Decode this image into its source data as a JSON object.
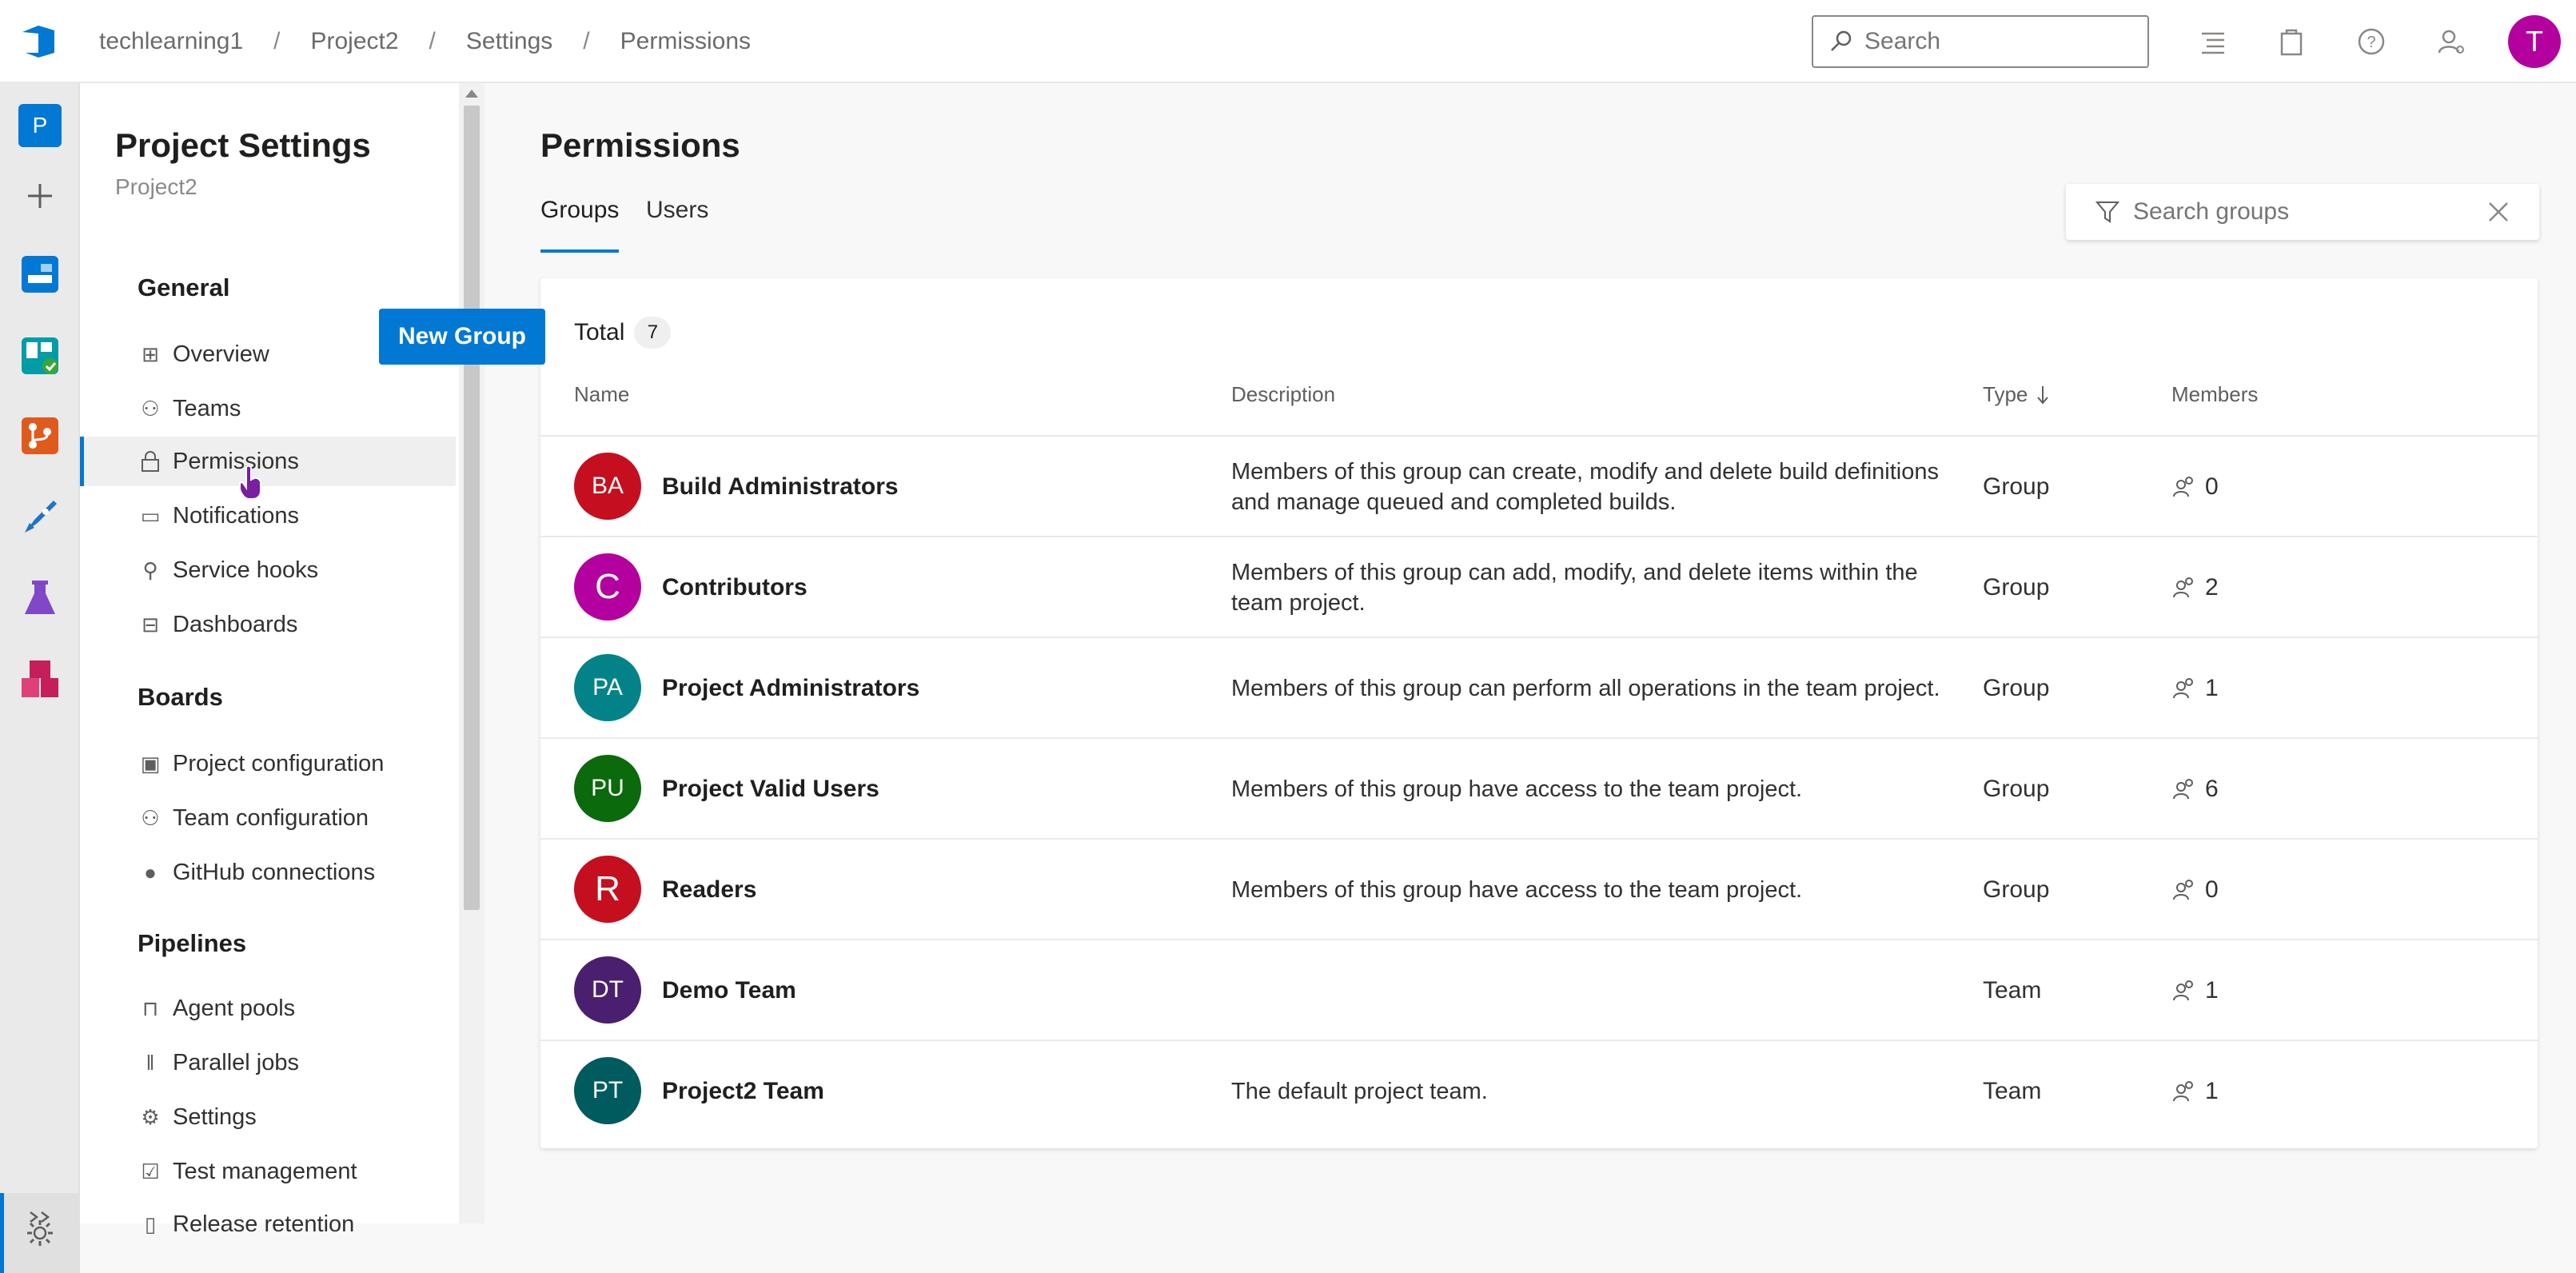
{
  "breadcrumb": [
    "techlearning1",
    "Project2",
    "Settings",
    "Permissions"
  ],
  "search": {
    "placeholder": "Search"
  },
  "user": {
    "initial": "T",
    "color": "#b4009e"
  },
  "project_badge": "P",
  "sidebar": {
    "title": "Project Settings",
    "subtitle": "Project2",
    "sections": [
      {
        "label": "General",
        "items": [
          {
            "label": "Overview",
            "icon": "overview-icon"
          },
          {
            "label": "Teams",
            "icon": "teams-icon"
          },
          {
            "label": "Permissions",
            "icon": "lock-icon",
            "active": true
          },
          {
            "label": "Notifications",
            "icon": "notification-icon"
          },
          {
            "label": "Service hooks",
            "icon": "service-hooks-icon"
          },
          {
            "label": "Dashboards",
            "icon": "dashboards-icon"
          }
        ]
      },
      {
        "label": "Boards",
        "items": [
          {
            "label": "Project configuration",
            "icon": "project-config-icon"
          },
          {
            "label": "Team configuration",
            "icon": "team-config-icon"
          },
          {
            "label": "GitHub connections",
            "icon": "github-icon"
          }
        ]
      },
      {
        "label": "Pipelines",
        "items": [
          {
            "label": "Agent pools",
            "icon": "agent-pools-icon"
          },
          {
            "label": "Parallel jobs",
            "icon": "parallel-jobs-icon"
          },
          {
            "label": "Settings",
            "icon": "gear-icon"
          },
          {
            "label": "Test management",
            "icon": "test-management-icon"
          },
          {
            "label": "Release retention",
            "icon": "retention-icon"
          }
        ]
      }
    ]
  },
  "main": {
    "title": "Permissions",
    "tabs": [
      {
        "label": "Groups",
        "active": true
      },
      {
        "label": "Users"
      }
    ],
    "filter_placeholder": "Search groups",
    "total_label": "Total",
    "total_count": "7",
    "new_group_label": "New Group",
    "columns": {
      "name": "Name",
      "description": "Description",
      "type": "Type",
      "members": "Members"
    },
    "groups": [
      {
        "initials": "BA",
        "color": "#c50f1f",
        "name": "Build Administrators",
        "description": "Members of this group can create, modify and delete build definitions and manage queued and completed builds.",
        "type": "Group",
        "members": "0"
      },
      {
        "initials": "C",
        "color": "#b4009e",
        "name": "Contributors",
        "description": "Members of this group can add, modify, and delete items within the team project.",
        "type": "Group",
        "members": "2"
      },
      {
        "initials": "PA",
        "color": "#038387",
        "name": "Project Administrators",
        "description": "Members of this group can perform all operations in the team project.",
        "type": "Group",
        "members": "1"
      },
      {
        "initials": "PU",
        "color": "#0b6a0b",
        "name": "Project Valid Users",
        "description": "Members of this group have access to the team project.",
        "type": "Group",
        "members": "6"
      },
      {
        "initials": "R",
        "color": "#c50f1f",
        "name": "Readers",
        "description": "Members of this group have access to the team project.",
        "type": "Group",
        "members": "0"
      },
      {
        "initials": "DT",
        "color": "#4b1f6f",
        "name": "Demo Team",
        "description": "",
        "type": "Team",
        "members": "1"
      },
      {
        "initials": "PT",
        "color": "#005b5e",
        "name": "Project2 Team",
        "description": "The default project team.",
        "type": "Team",
        "members": "1"
      }
    ]
  }
}
